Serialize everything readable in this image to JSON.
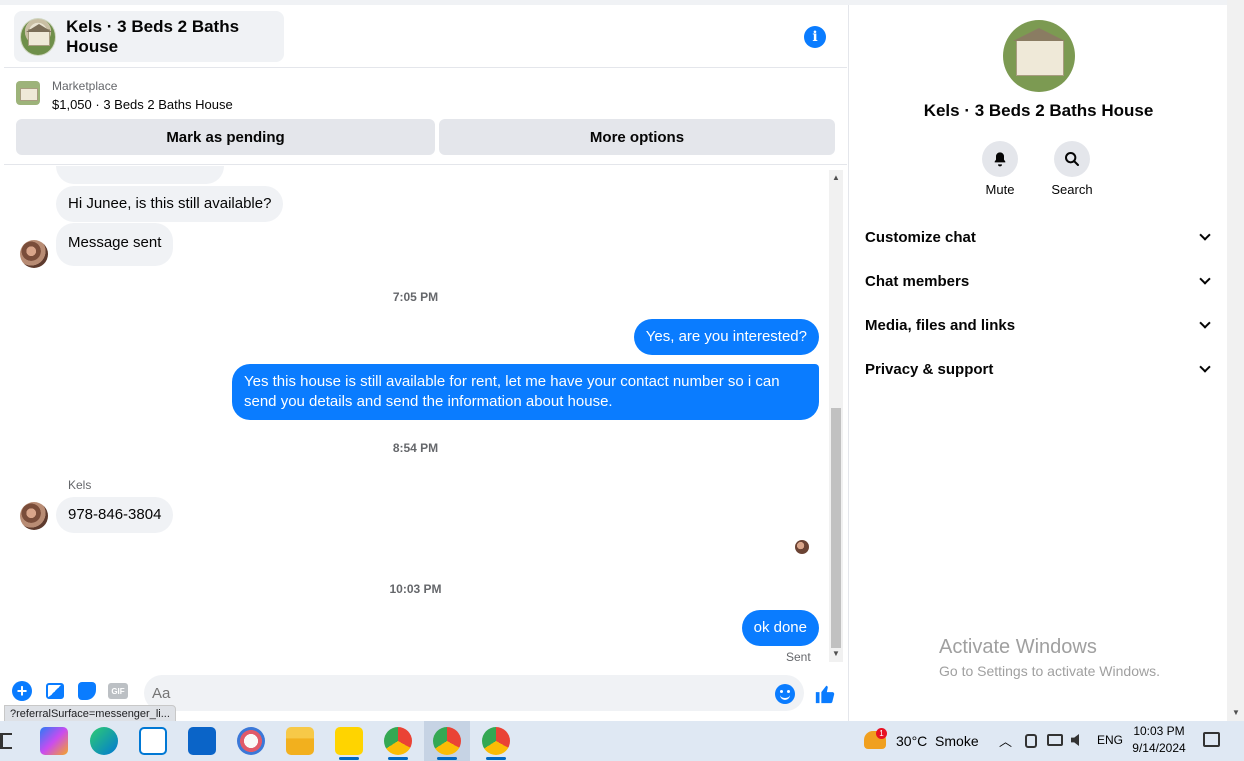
{
  "chat": {
    "title": "Kels · 3 Beds 2 Baths House",
    "info_icon": "info-icon"
  },
  "marketplace": {
    "label": "Marketplace",
    "item": "$1,050 · 3 Beds 2 Baths House",
    "pending_button": "Mark as pending",
    "more_button": "More options"
  },
  "messages": [
    {
      "direction": "in",
      "text": "Hi Junee, is this still available?"
    },
    {
      "direction": "in",
      "text": "Message sent"
    },
    {
      "timestamp": "7:05 PM"
    },
    {
      "direction": "out",
      "text": "Yes, are you interested?"
    },
    {
      "direction": "out",
      "text": "Yes this house is still available for rent, let me have your contact number so i can send you details and send the information about house."
    },
    {
      "timestamp": "8:54 PM"
    },
    {
      "direction": "in",
      "sender": "Kels",
      "text": "978-846-3804"
    },
    {
      "timestamp": "10:03 PM"
    },
    {
      "direction": "out",
      "text": "ok done",
      "status": "Sent"
    }
  ],
  "composer": {
    "placeholder": "Aa",
    "gif_label": "GIF"
  },
  "url_tooltip": "?referralSurface=messenger_li...",
  "info_panel": {
    "name": "Kels · 3 Beds 2 Baths House",
    "actions": [
      {
        "label": "Mute",
        "icon": "bell-icon"
      },
      {
        "label": "Search",
        "icon": "search-icon"
      }
    ],
    "sections": [
      {
        "label": "Customize chat"
      },
      {
        "label": "Chat members"
      },
      {
        "label": "Media, files and links"
      },
      {
        "label": "Privacy & support"
      }
    ]
  },
  "watermark": {
    "line1": "Activate Windows",
    "line2": "Go to Settings to activate Windows."
  },
  "taskbar": {
    "weather": "30°C  Smoke",
    "weather_badge": "1",
    "language": "ENG",
    "time": "10:03 PM",
    "date": "9/14/2024"
  },
  "colors": {
    "accent": "#0a7cff",
    "bubble_in": "#f0f2f5",
    "button_bg": "#e4e6eb"
  }
}
